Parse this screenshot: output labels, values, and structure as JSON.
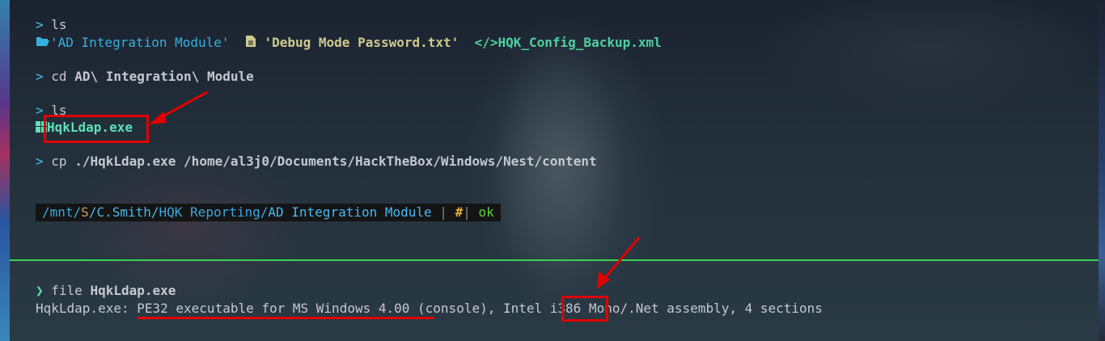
{
  "terminal": {
    "prompt_symbol": ">",
    "cmd1": "ls",
    "listing1": {
      "folder": "'AD Integration Module'",
      "textfile": "'Debug Mode Password.txt'",
      "xml_icon": "</>",
      "xmlfile": "HQK_Config_Backup.xml"
    },
    "cmd2_prefix": "cd ",
    "cmd2_arg": "AD\\ Integration\\ Module",
    "cmd3": "ls",
    "listing2": {
      "exe": "HqkLdap.exe"
    },
    "cmd4_prefix": "cp ",
    "cmd4_arg": "./HqkLdap.exe /home/al3j0/Documents/HackTheBox/Windows/Nest/content"
  },
  "statusbar": {
    "mnt": "/mnt/",
    "s": "S",
    "user": "/C.Smith/",
    "hqk": "HQK Reporting/",
    "ad": "AD Integration Module",
    "sep1": " | ",
    "hash": "#",
    "sep2": "| ",
    "ok": "ok"
  },
  "second_pane": {
    "prompt_symbol": "❯",
    "cmd_prefix": "file ",
    "cmd_arg": "HqkLdap.exe",
    "output_a": "HqkLdap.exe: ",
    "output_b": "PE32 executable for MS Windows 4.00",
    "output_c": " (console), Intel ",
    "output_d": "i386",
    "output_e": " Mono/.Net assembly, 4 sections"
  },
  "icons": [
    "folder-open-icon",
    "file-text-icon",
    "code-icon",
    "windows-icon"
  ],
  "colors": {
    "highlight": "#e00000",
    "divider": "#39d353",
    "accent": "#5fe0b8"
  }
}
